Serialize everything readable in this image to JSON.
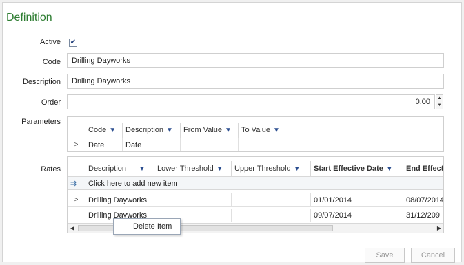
{
  "section_title": "Definition",
  "labels": {
    "active": "Active",
    "code": "Code",
    "description": "Description",
    "order": "Order",
    "parameters": "Parameters",
    "rates": "Rates"
  },
  "fields": {
    "active_checked": true,
    "active_mark": "✔",
    "code": "Drilling Dayworks",
    "description": "Drilling Dayworks",
    "order": "0.00"
  },
  "parameters_grid": {
    "columns": [
      "Code",
      "Description",
      "From Value",
      "To Value"
    ],
    "rows": [
      [
        "Date",
        "Date",
        "",
        ""
      ]
    ]
  },
  "rates_grid": {
    "columns": [
      "Description",
      "Lower Threshold",
      "Upper Threshold",
      "Start Effective Date",
      "End Effect"
    ],
    "add_row_text": "Click here to add new item",
    "rows": [
      [
        "Drilling Dayworks",
        "",
        "",
        "01/01/2014",
        "08/07/2014"
      ],
      [
        "Drilling Dayworks",
        "",
        "",
        "09/07/2014",
        "31/12/209"
      ]
    ]
  },
  "context_menu": {
    "delete_item": "Delete Item"
  },
  "buttons": {
    "save": "Save",
    "cancel": "Cancel"
  },
  "icons": {
    "filter": "filter-icon",
    "row_expand": "chevron-right-icon",
    "add_row": "add-row-icon",
    "spin_up": "spin-up-icon",
    "spin_down": "spin-down-icon"
  },
  "colors": {
    "title_green": "#2e7d32",
    "filter_blue": "#2a4d8f"
  }
}
